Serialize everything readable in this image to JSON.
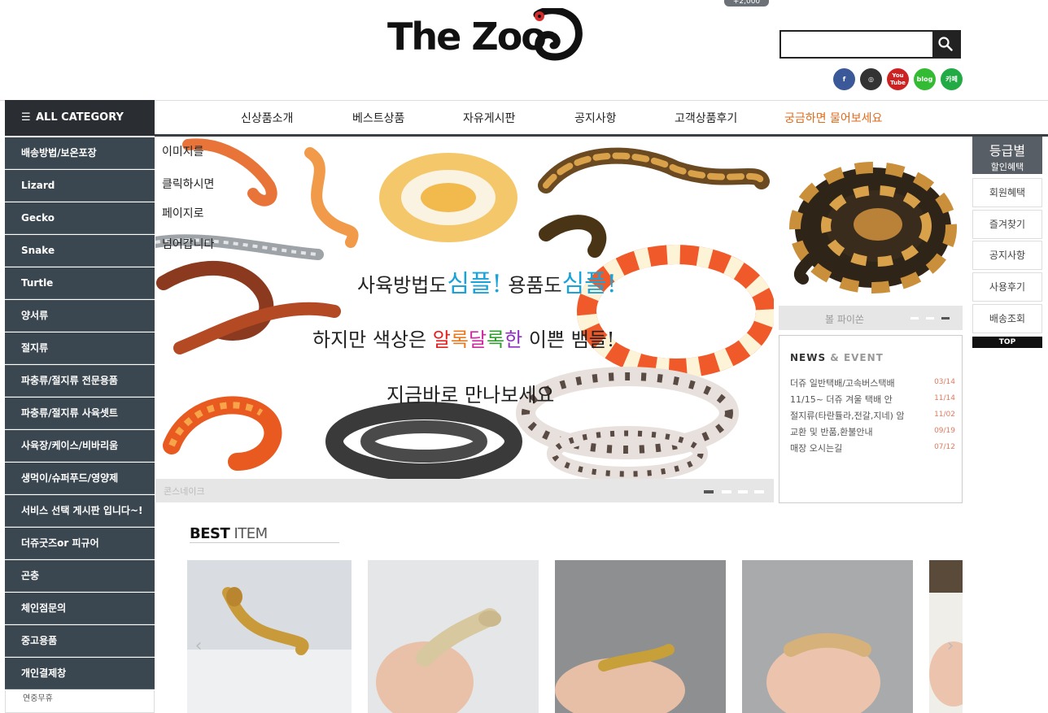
{
  "header": {
    "cart_badge": "+2,000",
    "logo_text": "The Zoo",
    "search": {
      "value": "",
      "placeholder": ""
    },
    "social": [
      {
        "icon": "facebook-icon",
        "label": "f",
        "color": "#3b5998"
      },
      {
        "icon": "instagram-icon",
        "label": "◎",
        "color": "#333333"
      },
      {
        "icon": "youtube-icon",
        "label": "You Tube",
        "color": "#cc2222"
      },
      {
        "icon": "blog-icon",
        "label": "blog",
        "color": "#33bb33"
      },
      {
        "icon": "cafe-icon",
        "label": "카페",
        "color": "#22aa44"
      }
    ]
  },
  "nav": {
    "items": [
      "신상품소개",
      "베스트상품",
      "자유게시판",
      "공지사항",
      "고객상품후기",
      "궁금하면 물어보세요"
    ]
  },
  "sidebar": {
    "title": "ALL CATEGORY",
    "items": [
      "배송방법/보온포장",
      "Lizard",
      "Gecko",
      "Snake",
      "Turtle",
      "양서류",
      "절지류",
      "파충류/절지류 전문용품",
      "파충류/절지류 사육셋트",
      "사육장/케이스/비바리움",
      "생먹이/슈퍼푸드/영양제",
      "서비스 선택 게시판 입니다~!",
      "더쥬굿즈or 피규어",
      "곤충",
      "체인점문의",
      "중고용품",
      "개인결제창"
    ],
    "footer_text": "연중무휴"
  },
  "banner": {
    "side_lines": [
      "이미지를",
      "클릭하시면",
      "페이지로",
      "넘어갑니다"
    ],
    "headline1_part1": "사육방법도",
    "headline1_simple1": "심플!",
    "headline1_part2": "용품도",
    "headline1_simple2": "심플!",
    "headline2_part1": "하지만  색상은",
    "headline2_colorful": [
      "알",
      "록",
      "달",
      "록",
      "한"
    ],
    "headline2_part2": "이쁜  뱀들!",
    "headline3": "지금바로  만나보세요",
    "caption": "콘스네이크",
    "slide_count": 4,
    "active_slide": 0
  },
  "side_banner": {
    "caption": "볼 파이쏜",
    "slide_count": 3,
    "active_slide": 2
  },
  "news": {
    "title_main": "NEWS",
    "title_amp": " & EVENT",
    "items": [
      {
        "text": "더쥬 일반택배/고속버스택배",
        "date": "03/14"
      },
      {
        "text": "11/15~ 더쥬 겨울 택배 안",
        "date": "11/14"
      },
      {
        "text": "절지류(타란튤라,전갈,지네) 암",
        "date": "11/02"
      },
      {
        "text": "교환 및 반품,환불안내",
        "date": "09/19"
      },
      {
        "text": "매장 오시는길",
        "date": "07/12"
      }
    ]
  },
  "quick_menu": {
    "grade_title": "등급별",
    "grade_sub": "할인혜택",
    "items": [
      "회원혜택",
      "즐겨찾기",
      "공지사항",
      "사용후기",
      "배송조회"
    ],
    "top_label": "TOP"
  },
  "best": {
    "title_bold": "BEST",
    "title_light": " ITEM"
  }
}
